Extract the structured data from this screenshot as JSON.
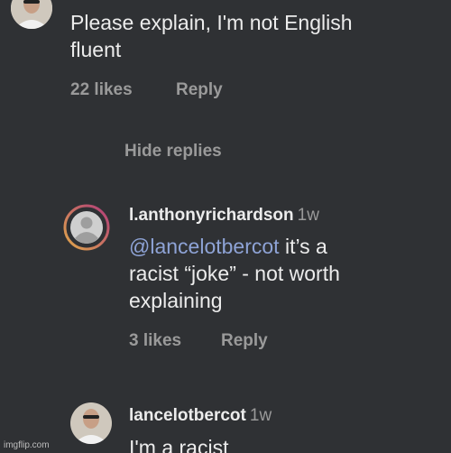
{
  "top_comment": {
    "text_line1": "Please explain, I'm not English",
    "text_line2": "fluent",
    "likes": "22 likes",
    "reply": "Reply"
  },
  "hide_replies": "Hide replies",
  "reply_1": {
    "username": "l.anthonyrichardson",
    "time": "1w",
    "mention": "@lancelotbercot",
    "text_line1_rest": " it’s a",
    "text_line2": "racist “joke” - not worth",
    "text_line3": "explaining",
    "likes": "3 likes",
    "reply": "Reply"
  },
  "reply_2": {
    "username": "lancelotbercot",
    "time": "1w",
    "text_partial": "I'm a racist"
  },
  "watermark": "imgflip.com",
  "colors": {
    "background": "#2f3134",
    "text": "#ececec",
    "meta": "#9a9a9a",
    "mention": "#8ea3d6",
    "story_ring_start": "#e0a84a",
    "story_ring_end": "#b13b7a"
  },
  "icons": [
    "user-avatar-icon",
    "default-avatar-icon"
  ]
}
